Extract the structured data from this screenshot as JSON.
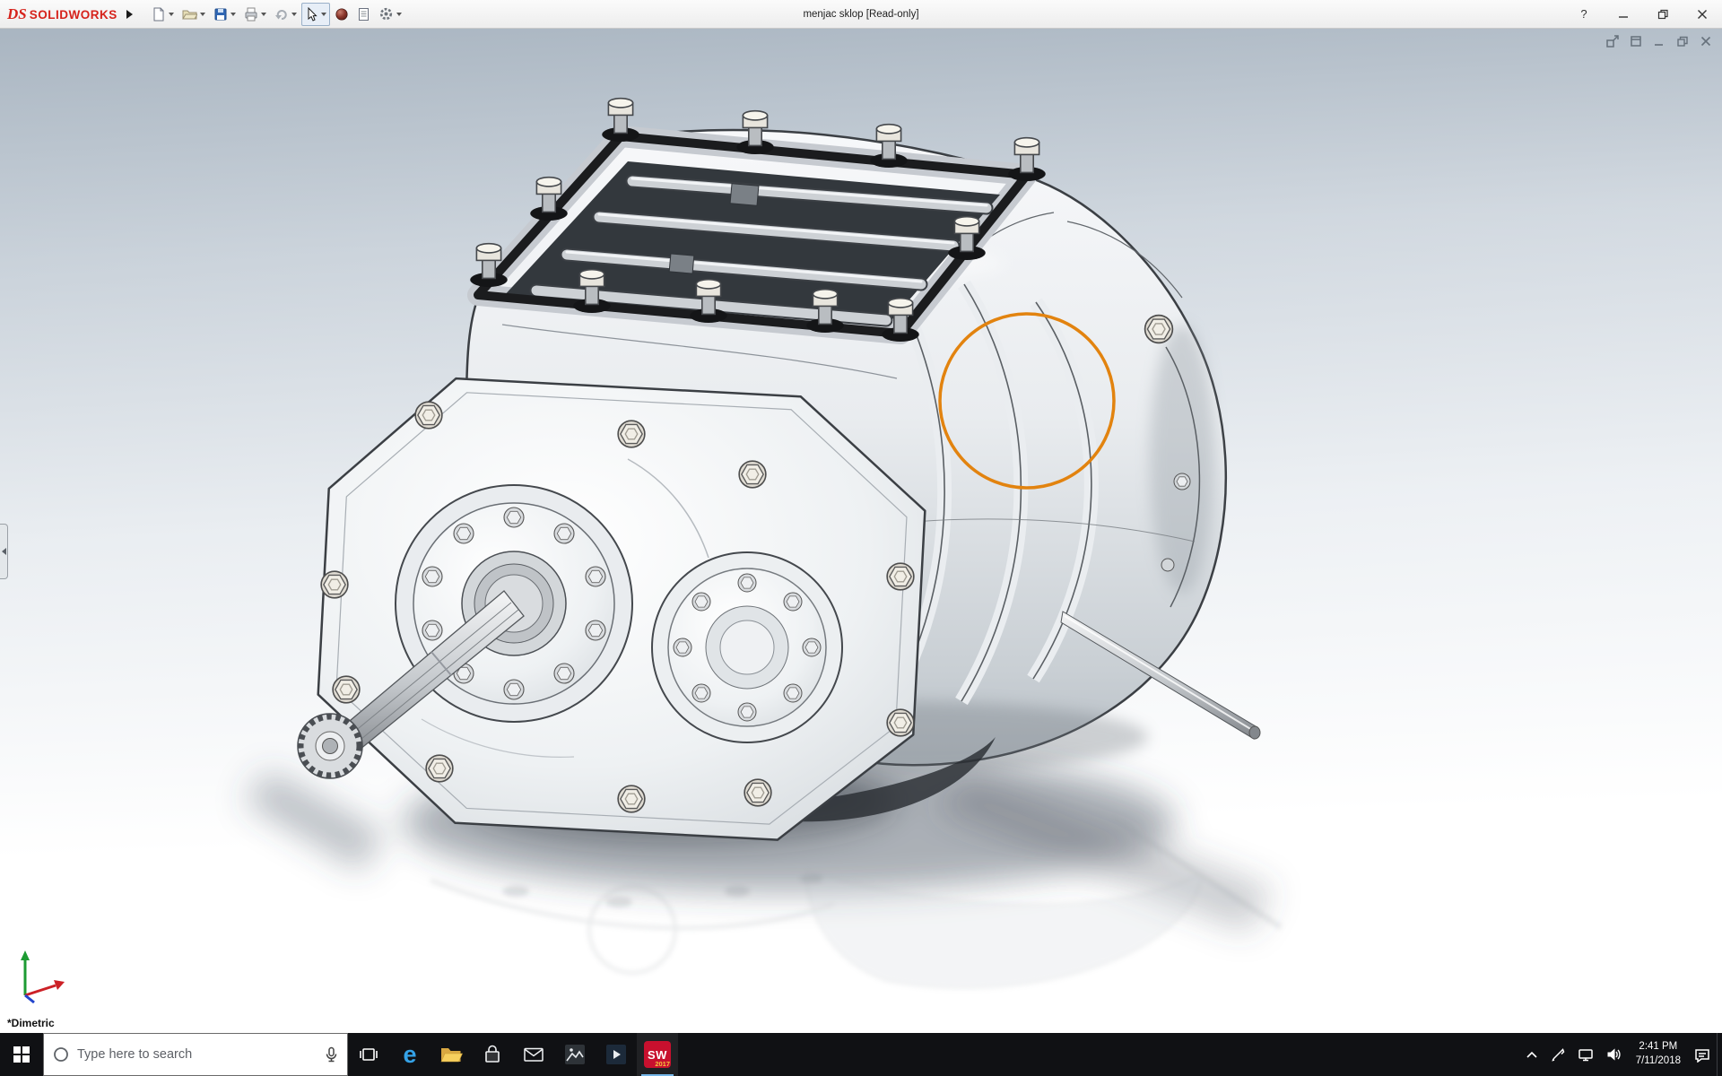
{
  "titlebar": {
    "brand_mark": "DS",
    "brand_name": "SOLIDWORKS",
    "document_title": "menjac sklop [Read-only]",
    "help_label": "?",
    "toolbar_icons": [
      "menu-expand",
      "new-document",
      "open",
      "save",
      "print",
      "undo",
      "select-arrow",
      "appearances-sphere",
      "file-properties",
      "options-gear"
    ]
  },
  "document_window": {
    "controls": [
      "promote-panes",
      "new-window",
      "minimize",
      "restore",
      "close"
    ]
  },
  "viewport": {
    "view_orientation_label": "*Dimetric",
    "annotation_circle_color": "#E2830F",
    "triad_axis_colors": {
      "x": "#CC2026",
      "y": "#1D9B33",
      "z": "#2244CC"
    }
  },
  "taskbar": {
    "search_placeholder": "Type here to search",
    "edge_glyph": "e",
    "app_icons": [
      "start",
      "task-view",
      "edge",
      "file-explorer",
      "store",
      "mail",
      "photos",
      "movies-tv",
      "solidworks"
    ],
    "solidworks_badge": {
      "top": "SW",
      "bottom": "2017"
    },
    "tray_icons": [
      "hidden-icons-chevron",
      "pen",
      "network",
      "volume",
      "action-center"
    ],
    "clock": {
      "time": "2:41 PM",
      "date": "7/11/2018"
    }
  }
}
